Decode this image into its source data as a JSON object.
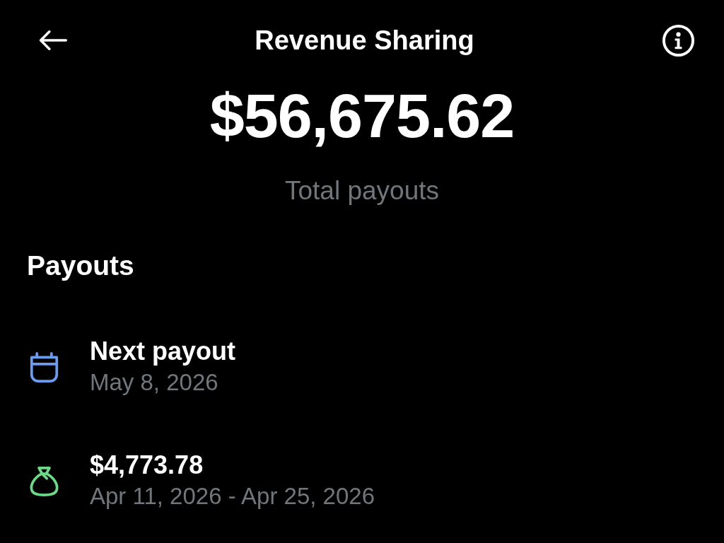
{
  "header": {
    "title": "Revenue Sharing"
  },
  "summary": {
    "amount": "$56,675.62",
    "label": "Total payouts"
  },
  "payouts": {
    "heading": "Payouts",
    "items": [
      {
        "kind": "calendar",
        "color": "#6a9cf0",
        "title": "Next payout",
        "subtitle": "May 8, 2026"
      },
      {
        "kind": "bag",
        "color": "#6cd888",
        "title": "$4,773.78",
        "subtitle": "Apr 11, 2026 - Apr 25, 2026"
      }
    ]
  }
}
